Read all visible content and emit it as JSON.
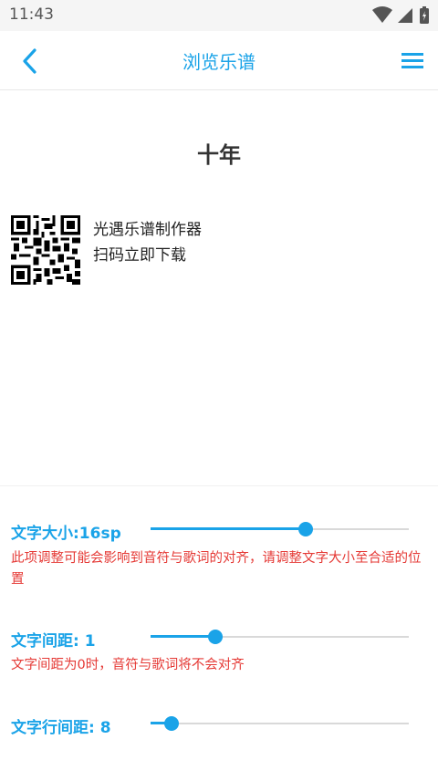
{
  "status": {
    "time": "11:43"
  },
  "header": {
    "title": "浏览乐谱"
  },
  "sheet": {
    "title": "十年",
    "promo_line1": "光遇乐谱制作器",
    "promo_line2": "扫码立即下载"
  },
  "settings": {
    "font_size": {
      "label": "文字大小:16sp",
      "level": 0.6,
      "hint": "此项调整可能会影响到音符与歌词的对齐，请调整文字大小至合适的位置"
    },
    "letter_spacing": {
      "label": "文字间距: 1",
      "level": 0.25,
      "hint": "文字间距为0时，音符与歌词将不会对齐"
    },
    "line_spacing": {
      "label": "文字行间距: 8",
      "level": 0.08
    }
  },
  "colors": {
    "accent": "#1aa3e8",
    "warning": "#e53935",
    "track": "#d9d9d9"
  }
}
